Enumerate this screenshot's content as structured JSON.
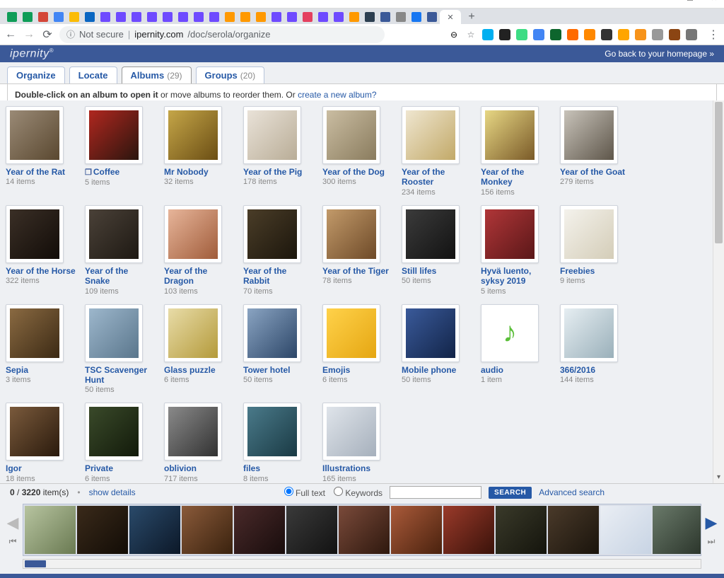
{
  "window": {
    "minimize": "—",
    "maximize": "☐",
    "close": "✕"
  },
  "chrome": {
    "nav": {
      "back": "←",
      "forward": "→",
      "reload": "⟳"
    },
    "omnibox": {
      "info": "ⓘ",
      "not_secure": "Not secure",
      "host": "ipernity.com",
      "path": "/doc/serola/organize",
      "zoom": "⊖",
      "star": "☆"
    },
    "active_tab_close": "✕",
    "new_tab": "+",
    "menu": "⋮"
  },
  "header": {
    "logo": "ipernity",
    "go_back": "Go back to your homepage »"
  },
  "tabs": {
    "organize": "Organize",
    "locate": "Locate",
    "albums": "Albums",
    "albums_count": "(29)",
    "groups": "Groups",
    "groups_count": "(20)"
  },
  "instruction": {
    "bold": "Double-click on an album to open it",
    "rest": " or move albums to reorder them. Or ",
    "link": "create a new album?"
  },
  "albums": [
    {
      "title": "Year of the Rat",
      "items": "14 items",
      "c1": "#9a8a76",
      "c2": "#5a4830"
    },
    {
      "title": "Coffee",
      "items": "5 items",
      "stack": true,
      "c1": "#b0271f",
      "c2": "#2a150e"
    },
    {
      "title": "Mr Nobody",
      "items": "32 items",
      "c1": "#c5a648",
      "c2": "#6b4e14"
    },
    {
      "title": "Year of the Pig",
      "items": "178 items",
      "c1": "#e9e2d8",
      "c2": "#b9ad97"
    },
    {
      "title": "Year of the Dog",
      "items": "300 items",
      "c1": "#cabda2",
      "c2": "#8a7c5e"
    },
    {
      "title": "Year of the Rooster",
      "items": "234 items",
      "c1": "#efe6d0",
      "c2": "#c2a968"
    },
    {
      "title": "Year of the Monkey",
      "items": "156 items",
      "c1": "#e7d784",
      "c2": "#7a5a28"
    },
    {
      "title": "Year of the Goat",
      "items": "279 items",
      "c1": "#c8c3ba",
      "c2": "#5e564a"
    },
    {
      "title": "Year of the Horse",
      "items": "322 items",
      "c1": "#3a2f26",
      "c2": "#120c08"
    },
    {
      "title": "Year of the Snake",
      "items": "109 items",
      "c1": "#4a4138",
      "c2": "#1e1913"
    },
    {
      "title": "Year of the Dragon",
      "items": "103 items",
      "c1": "#e7b59a",
      "c2": "#a05c3a"
    },
    {
      "title": "Year of the Rabbit",
      "items": "70 items",
      "c1": "#4a3d28",
      "c2": "#1c160c"
    },
    {
      "title": "Year of the Tiger",
      "items": "78 items",
      "c1": "#c29a6a",
      "c2": "#6e4a28"
    },
    {
      "title": "Still lifes",
      "items": "50 items",
      "c1": "#3b3b3b",
      "c2": "#121212"
    },
    {
      "title": "Hyvä luento, syksy 2019",
      "items": "5 items",
      "c1": "#b03638",
      "c2": "#5a1718"
    },
    {
      "title": "Freebies",
      "items": "9 items",
      "c1": "#f4f2ec",
      "c2": "#d4cdb8"
    },
    {
      "title": "Sepia",
      "items": "3 items",
      "c1": "#8a6a42",
      "c2": "#3c2a14"
    },
    {
      "title": "TSC Scavenger Hunt",
      "items": "50 items",
      "c1": "#9db7cc",
      "c2": "#5a768c"
    },
    {
      "title": "Glass puzzle",
      "items": "6 items",
      "c1": "#e8dca8",
      "c2": "#b49a3a"
    },
    {
      "title": "Tower hotel",
      "items": "50 items",
      "c1": "#8aa4c2",
      "c2": "#2c4668"
    },
    {
      "title": "Emojis",
      "items": "6 items",
      "c1": "#ffd24a",
      "c2": "#e5a612"
    },
    {
      "title": "Mobile phone",
      "items": "50 items",
      "c1": "#3a5a9a",
      "c2": "#122448"
    },
    {
      "title": "audio",
      "items": "1 item",
      "c1": "#ffffff",
      "c2": "#ffffff",
      "icon": "♪",
      "iconColor": "#5bbf3a"
    },
    {
      "title": "366/2016",
      "items": "144 items",
      "c1": "#e6eef2",
      "c2": "#9ab0ba"
    },
    {
      "title": "Igor",
      "items": "18 items",
      "c1": "#7a5a3c",
      "c2": "#2a1a0c"
    },
    {
      "title": "Private",
      "items": "6 items",
      "c1": "#3a4a2a",
      "c2": "#121a0a"
    },
    {
      "title": "oblivion",
      "items": "717 items",
      "c1": "#8a8a8a",
      "c2": "#323232"
    },
    {
      "title": "files",
      "items": "8 items",
      "c1": "#4a7a8a",
      "c2": "#1a3a44"
    },
    {
      "title": "Illustrations",
      "items": "165 items",
      "c1": "#dfe4ea",
      "c2": "#a6b0bc"
    }
  ],
  "bottom": {
    "count_current": "0",
    "count_sep": " / ",
    "count_total": "3220",
    "count_suffix": " item(s)",
    "dot": "•",
    "show_details": "show details",
    "full_text": "Full text",
    "keywords": "Keywords",
    "search_btn": "SEARCH",
    "advanced": "Advanced search",
    "prev": "◀",
    "next": "▶",
    "first": "⏮",
    "last": "⏭"
  },
  "filmstrip_colors": [
    [
      "#b7c4a0",
      "#6a7a52"
    ],
    [
      "#3a2a1a",
      "#120c06"
    ],
    [
      "#2a4a6a",
      "#0c1828"
    ],
    [
      "#8a5a3a",
      "#3a220e"
    ],
    [
      "#4a2a2a",
      "#180c0c"
    ],
    [
      "#3a3a3a",
      "#121212"
    ],
    [
      "#7a4a3a",
      "#2e180e"
    ],
    [
      "#aa5a3a",
      "#4a220e"
    ],
    [
      "#9a3a2a",
      "#3a120a"
    ],
    [
      "#3a3a2a",
      "#14140c"
    ],
    [
      "#4a3a2a",
      "#1a140c"
    ],
    [
      "#eaeef4",
      "#c8d4e4"
    ],
    [
      "#6a7a6a",
      "#2a342a"
    ]
  ],
  "tab_favicons": [
    "#0F9D58",
    "#0F9D58",
    "#D44638",
    "#4285F4",
    "#FBBC05",
    "#0A66C2",
    "#6E4AFF",
    "#6E4AFF",
    "#6E4AFF",
    "#6E4AFF",
    "#6E4AFF",
    "#6E4AFF",
    "#6E4AFF",
    "#6E4AFF",
    "#FF9900",
    "#FF9900",
    "#FF9900",
    "#6E4AFF",
    "#6E4AFF",
    "#E4405F",
    "#6E4AFF",
    "#6E4AFF",
    "#FF9900",
    "#2C3E50",
    "#3b5998",
    "#888",
    "#1877F2",
    "#3b5998"
  ],
  "ext_colors": [
    "#00AFF0",
    "#222",
    "#3DDC84",
    "#4285F4",
    "#0d652d",
    "#FF6A00",
    "#FF8800",
    "#333",
    "#FFA500",
    "#F7931A",
    "#999",
    "#8B4513",
    "#777"
  ]
}
